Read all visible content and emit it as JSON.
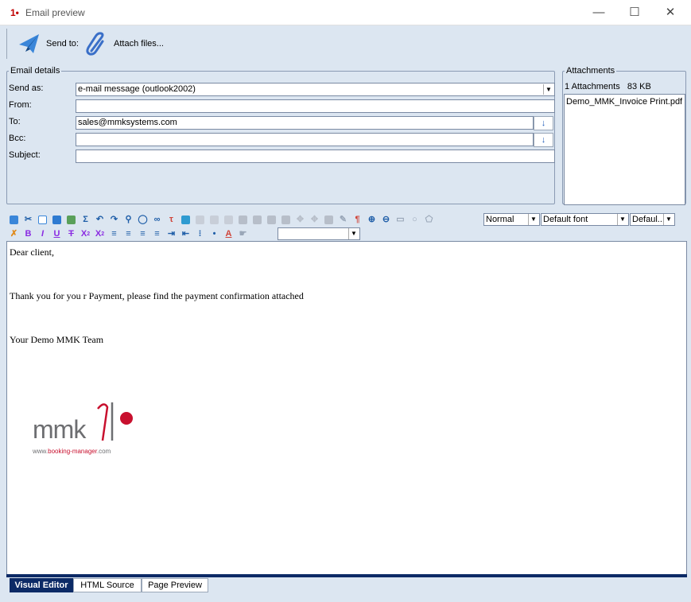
{
  "window": {
    "title": "Email preview",
    "app_glyph": "1•"
  },
  "toolbar": {
    "send_label": "Send to:",
    "attach_label": "Attach files..."
  },
  "email_details": {
    "legend": "Email details",
    "send_as_label": "Send as:",
    "send_as_value": "e-mail message (outlook2002)",
    "from_label": "From:",
    "from_value": "",
    "to_label": "To:",
    "to_value": "sales@mmksystems.com",
    "bcc_label": "Bcc:",
    "bcc_value": "",
    "subject_label": "Subject:",
    "subject_value": ""
  },
  "attachments": {
    "legend": "Attachments",
    "summary": "1 Attachments   83 KB",
    "files": [
      "Demo_MMK_Invoice Print.pdf"
    ]
  },
  "format_bar": {
    "style_value": "Normal",
    "font_value": "Default font",
    "size_value": "Defaul...",
    "color_value": ""
  },
  "editor": {
    "line1": "Dear client,",
    "line2": "Thank you for you r Payment, please find the payment confirmation attached",
    "line3": "Your Demo MMK Team",
    "logo_text": "mmk",
    "logo_url_pre": "www.",
    "logo_url_brand": "booking-manager",
    "logo_url_post": ".com"
  },
  "tabs": [
    {
      "label": "Visual Editor",
      "active": true
    },
    {
      "label": "HTML Source",
      "active": false
    },
    {
      "label": "Page Preview",
      "active": false
    }
  ],
  "colors": {
    "accent_dark_blue": "#0c2a66",
    "background": "#dce6f1",
    "logo_red": "#c8102e",
    "logo_gray": "#6d6e71"
  }
}
